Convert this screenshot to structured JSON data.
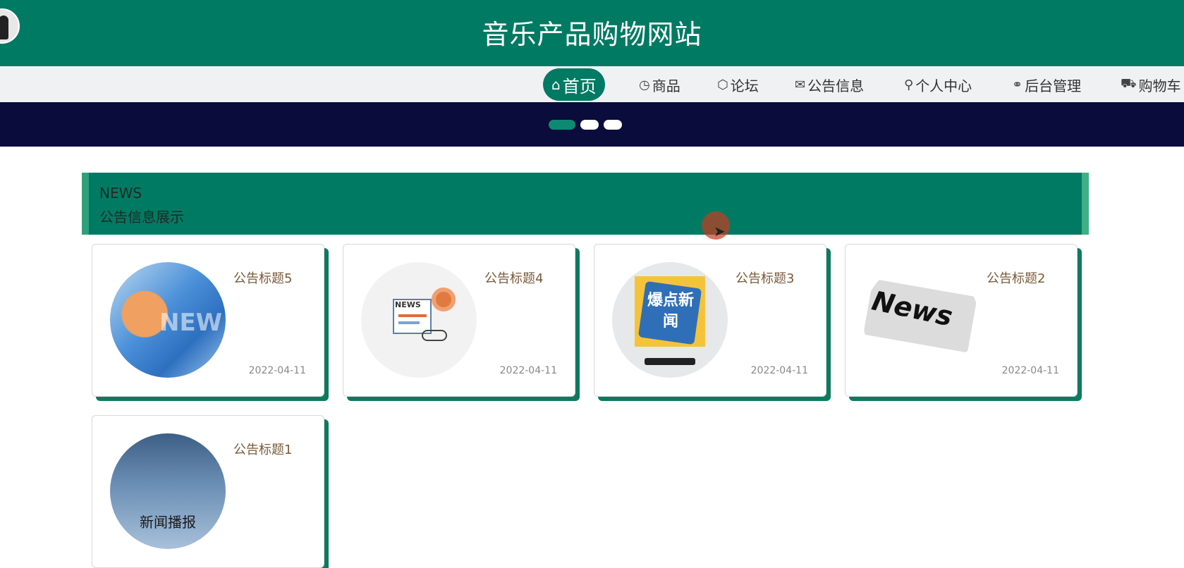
{
  "header": {
    "title": "音乐产品购物网站"
  },
  "nav": {
    "items": [
      {
        "label": "首页",
        "icon": "home-icon",
        "glyph": "⌂"
      },
      {
        "label": "商品",
        "icon": "gauge-icon",
        "glyph": "◷"
      },
      {
        "label": "论坛",
        "icon": "cube-icon",
        "glyph": "⬡"
      },
      {
        "label": "公告信息",
        "icon": "mail-icon",
        "glyph": "✉"
      },
      {
        "label": "个人中心",
        "icon": "user-icon",
        "glyph": "⚲"
      },
      {
        "label": "后台管理",
        "icon": "link-icon",
        "glyph": "⚭"
      },
      {
        "label": "购物车",
        "icon": "cart-icon",
        "glyph": "⛟"
      }
    ]
  },
  "section": {
    "en": "NEWS",
    "cn": "公告信息展示"
  },
  "news": [
    {
      "title": "公告标题5",
      "date": "2022-04-11",
      "image_text": "NEW"
    },
    {
      "title": "公告标题4",
      "date": "2022-04-11",
      "image_text": "NEWS"
    },
    {
      "title": "公告标题3",
      "date": "2022-04-11",
      "image_text": "爆点新闻"
    },
    {
      "title": "公告标题2",
      "date": "2022-04-11",
      "image_text": "News"
    },
    {
      "title": "公告标题1",
      "date": "",
      "image_text": "新闻播报"
    }
  ],
  "colors": {
    "primary": "#007a63",
    "banner": "#0a0c3c",
    "title_text": "#7a5a3a"
  }
}
